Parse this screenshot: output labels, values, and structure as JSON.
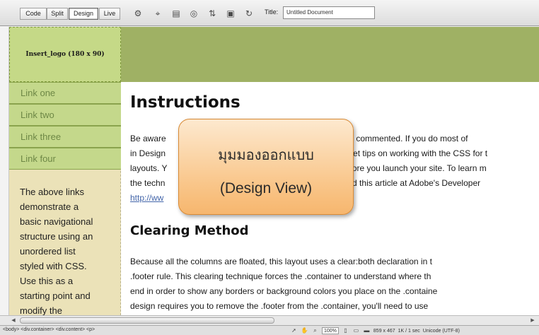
{
  "toolbar": {
    "views": [
      {
        "label": "Code"
      },
      {
        "label": "Split"
      },
      {
        "label": "Design"
      },
      {
        "label": "Live"
      }
    ],
    "icons": [
      "live-code-icon",
      "inspect-icon",
      "multiscreen-icon",
      "preview-browser-icon",
      "file-management-icon",
      "visual-aids-icon",
      "refresh-icon"
    ],
    "title_label": "Title:",
    "title_value": "Untitled Document"
  },
  "page": {
    "logo_placeholder": "Insert_logo (180 x 90)",
    "nav_links": [
      "Link one",
      "Link two",
      "Link three",
      "Link four"
    ],
    "sidebar_text_lines": [
      "The above links",
      "demonstrate a",
      "basic navigational",
      "structure using an",
      "unordered list",
      "styled with CSS.",
      "Use this as a",
      "starting point and",
      "modify the"
    ],
    "heading_instructions": "Instructions",
    "instructions_lines": [
      {
        "a": "Be aware ",
        "b": "avily commented. If you do most of"
      },
      {
        "a": "in Design",
        "b": "et tips on working with the CSS for t"
      },
      {
        "a": "layouts. Y",
        "b": "fore you launch your site. To learn m"
      },
      {
        "a": "the techn",
        "b": "ad this article at Adobe's Developer"
      },
      {
        "a": "http://ww",
        "b": ""
      }
    ],
    "heading_clearing": "Clearing Method",
    "clearing_lines": [
      "Because all the columns are floated, this layout uses a clear:both declaration in t",
      ".footer rule. This clearing technique forces the .container to understand where th",
      "end in order to show any borders or background colors you place on the .containe",
      "design requires you to remove the .footer from the .container, you'll need to use"
    ]
  },
  "callout": {
    "thai_text": "มุมมองออกแบบ",
    "english_text": "(Design View)",
    "colors": {
      "fill": "#f9c588",
      "border": "#d98b36"
    }
  },
  "statusbar": {
    "tag_path": "<body> <div.container> <div.content> <p>",
    "zoom": "100%",
    "dimensions": "859 x 467",
    "file_info": "1K / 1 sec",
    "encoding": "Unicode (UTF-8)",
    "icons": [
      "select-tool-icon",
      "hand-tool-icon",
      "zoom-tool-icon",
      "mobile-size-icon",
      "tablet-size-icon",
      "desktop-size-icon"
    ]
  },
  "colors": {
    "header_band": "#9fb164",
    "logo_box": "#c5d987",
    "nav_link_bg": "#c4d88b",
    "nav_link_text": "#6e8846",
    "sidebar_bg": "#ebe2b8"
  }
}
